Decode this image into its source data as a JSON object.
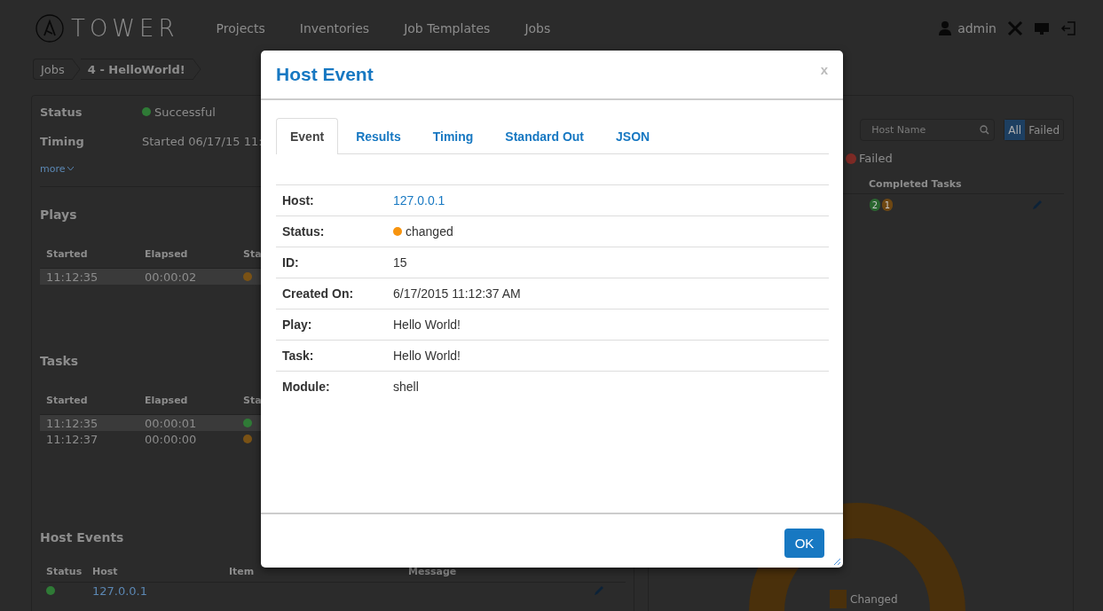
{
  "nav": {
    "logo": "TOWER",
    "links": [
      "Projects",
      "Inventories",
      "Job Templates",
      "Jobs"
    ],
    "user": "admin"
  },
  "breadcrumb": [
    "Jobs",
    "4 - HelloWorld!"
  ],
  "job_summary": {
    "fields": [
      {
        "label": "Status",
        "value": "Successful",
        "color": "#2f7a36"
      },
      {
        "label": "Timing",
        "value": "Started  06/17/15 11:"
      }
    ],
    "more_link": "more"
  },
  "plays": {
    "title": "Plays",
    "columns": [
      "Started",
      "Elapsed",
      "Sta"
    ],
    "rows": [
      {
        "started": "11:12:35",
        "elapsed": "00:00:02",
        "color": "#7a5215",
        "selected": true
      }
    ]
  },
  "tasks": {
    "title": "Tasks",
    "columns": [
      "Started",
      "Elapsed",
      "Sta"
    ],
    "rows": [
      {
        "started": "11:12:35",
        "elapsed": "00:00:01",
        "color": "#2f7a36",
        "selected": true
      },
      {
        "started": "11:12:37",
        "elapsed": "00:00:00",
        "color": "#7a5215",
        "selected": false
      }
    ]
  },
  "host_events": {
    "title": "Host Events",
    "columns": [
      "Status",
      "Host",
      "Item",
      "Message"
    ],
    "rows": [
      {
        "host": "127.0.0.1",
        "color": "#2f7a36"
      }
    ]
  },
  "host_summary": {
    "search": {
      "placeholder": "Host Name"
    },
    "filters": [
      {
        "label": "All",
        "selected": true
      },
      {
        "label": "Failed",
        "selected": false
      }
    ],
    "legend": [
      {
        "label": "Failed",
        "color": "#7d2a25"
      }
    ],
    "columns": [
      "Completed Tasks"
    ],
    "rows": [
      {
        "badges": [
          {
            "count": "2",
            "color": "#2a6630"
          },
          {
            "count": "1",
            "color": "#6e4712"
          }
        ]
      }
    ]
  },
  "donut": {
    "legend": [
      {
        "label": "Changed",
        "color": "#4a300b"
      }
    ]
  },
  "modal": {
    "title": "Host Event",
    "close": "x",
    "tabs": [
      {
        "label": "Event",
        "selected": true
      },
      {
        "label": "Results",
        "selected": false
      },
      {
        "label": "Timing",
        "selected": false
      },
      {
        "label": "Standard Out",
        "selected": false
      },
      {
        "label": "JSON",
        "selected": false
      }
    ],
    "fields": [
      {
        "label": "Host:",
        "value": "127.0.0.1",
        "kind": "link"
      },
      {
        "label": "Status:",
        "value": "changed",
        "kind": "status",
        "color": "#f7940f"
      },
      {
        "label": "ID:",
        "value": "15",
        "kind": "text"
      },
      {
        "label": "Created On:",
        "value": "6/17/2015 11:12:37 AM",
        "kind": "text"
      },
      {
        "label": "Play:",
        "value": "Hello World!",
        "kind": "text"
      },
      {
        "label": "Task:",
        "value": "Hello World!",
        "kind": "text"
      },
      {
        "label": "Module:",
        "value": "shell",
        "kind": "text"
      }
    ],
    "ok": "OK"
  }
}
